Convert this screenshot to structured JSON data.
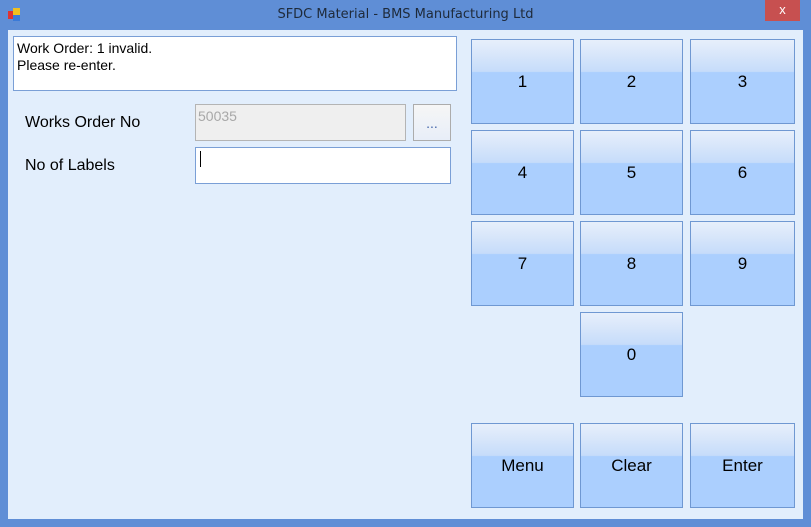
{
  "window": {
    "title": "SFDC Material - BMS Manufacturing Ltd",
    "close_label": "x"
  },
  "message": {
    "line1": "Work Order: 1 invalid.",
    "line2": "Please re-enter."
  },
  "form": {
    "works_order_label": "Works Order No",
    "works_order_value": "50035",
    "browse_label": "...",
    "labels_label": "No of Labels",
    "labels_value": ""
  },
  "keypad": {
    "k1": "1",
    "k2": "2",
    "k3": "3",
    "k4": "4",
    "k5": "5",
    "k6": "6",
    "k7": "7",
    "k8": "8",
    "k9": "9",
    "k0": "0"
  },
  "actions": {
    "menu": "Menu",
    "clear": "Clear",
    "enter": "Enter"
  }
}
